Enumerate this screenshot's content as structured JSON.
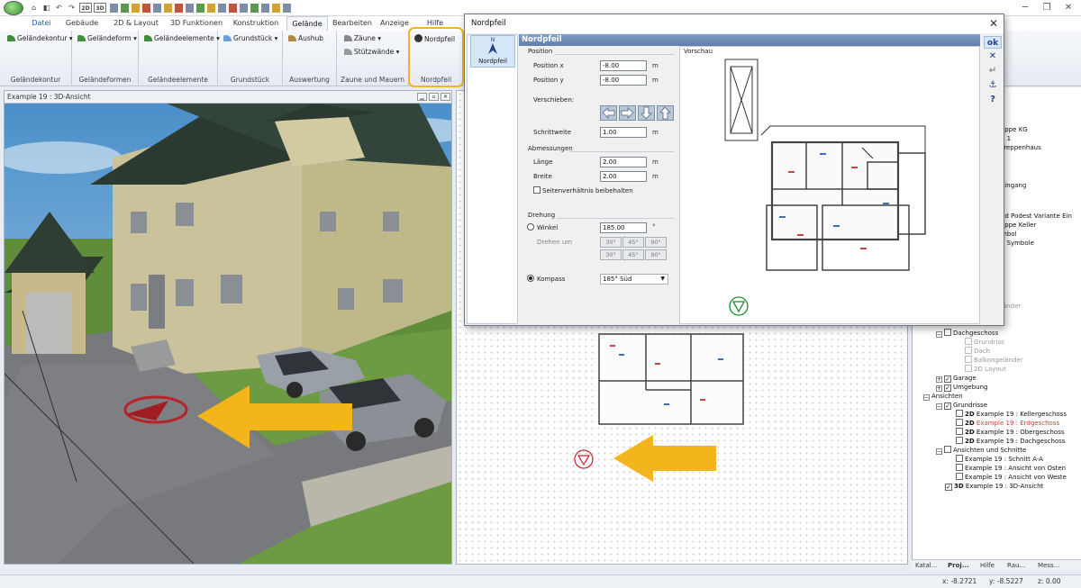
{
  "qat": {
    "items": [
      "⌂",
      "◧",
      "↶",
      "↷",
      "2D",
      "3D"
    ]
  },
  "ribbon": {
    "tabs": [
      "Datei",
      "Gebäude",
      "2D & Layout",
      "3D Funktionen",
      "Konstruktion",
      "Gelände",
      "Bearbeiten",
      "Anzeige",
      "Hilfe"
    ],
    "active_tab": "Gelände",
    "groups": [
      {
        "label": "Geländekontur",
        "buttons": [
          "Geländekontur ▾"
        ]
      },
      {
        "label": "Geländeformen",
        "buttons": [
          "Geländeform ▾"
        ]
      },
      {
        "label": "Geländeelemente",
        "buttons": [
          "Geländeelemente ▾"
        ]
      },
      {
        "label": "Grundstück",
        "buttons": [
          "Grundstück ▾"
        ]
      },
      {
        "label": "Auswertung",
        "buttons": [
          "Aushub"
        ]
      },
      {
        "label": "Zaune und Mauern",
        "buttons": [
          "Zäune ▾",
          "Stützwände ▾"
        ]
      },
      {
        "label": "Nordpfeil",
        "buttons": [
          "Nordpfeil"
        ]
      }
    ],
    "highlight_color": "#f2b51b"
  },
  "left_pane": {
    "title": "Example 19 : 3D-Ansicht"
  },
  "dialog": {
    "title": "Nordpfeil",
    "close": "✕",
    "sidebar": {
      "compass_letter": "N",
      "item": "Nordpfeil"
    },
    "header": "Nordpfeil",
    "position": {
      "section": "Position",
      "x_label": "Position x",
      "x_value": "-8.00",
      "y_label": "Position y",
      "y_value": "-8.00",
      "unit": "m",
      "move_label": "Verschieben:",
      "step_label": "Schrittweite",
      "step_value": "1.00"
    },
    "size": {
      "section": "Abmessungen",
      "length_label": "Länge",
      "length_value": "2.00",
      "width_label": "Breite",
      "width_value": "2.00",
      "unit": "m",
      "ratio_label": "Seitenverhältnis beibehalten"
    },
    "rotation": {
      "section": "Drehung",
      "angle_label": "Winkel",
      "angle_value": "185.00",
      "angle_unit": "°",
      "rotate_label": "Drehen um",
      "buttons": [
        "30°",
        "45°",
        "90°",
        "30°",
        "45°",
        "90°"
      ],
      "compass_label": "Kompass",
      "compass_value": "185° Süd"
    },
    "preview_label": "Vorschau",
    "side_buttons": [
      "ok",
      "✕",
      "↵",
      "⚓",
      "?"
    ]
  },
  "tree": {
    "partial": [
      "oppe KG",
      "E 1",
      "Treppenhaus",
      "eingang",
      "nd Podest Variante Ein",
      "oppe Keller",
      "mbol",
      "e Symbole",
      "länder"
    ],
    "items": [
      {
        "label": "Dachgeschoss",
        "indent": 0
      },
      {
        "label": "Grundriss",
        "indent": 1,
        "grey": true
      },
      {
        "label": "Dach",
        "indent": 1,
        "grey": true
      },
      {
        "label": "Balkongeländer",
        "indent": 1,
        "grey": true
      },
      {
        "label": "2D Layout",
        "indent": 1,
        "grey": true
      },
      {
        "label": "Garage",
        "indent": 0
      },
      {
        "label": "Umgebung",
        "indent": 0
      },
      {
        "label": "Ansichten",
        "indent": -1
      },
      {
        "label": "Grundrisse",
        "indent": 0
      },
      {
        "label": "Example 19 : Kellergeschoss",
        "indent": 1,
        "prefix": "2D"
      },
      {
        "label": "Example 19 : Erdgeschoss",
        "indent": 1,
        "prefix": "2D",
        "red": true
      },
      {
        "label": "Example 19 : Obergeschoss",
        "indent": 1,
        "prefix": "2D"
      },
      {
        "label": "Example 19 : Dachgeschoss",
        "indent": 1,
        "prefix": "2D"
      },
      {
        "label": "Ansichten und Schnitte",
        "indent": 0
      },
      {
        "label": "Example 19 : Schnitt A-A",
        "indent": 1
      },
      {
        "label": "Example 19 : Ansicht von Osten",
        "indent": 1
      },
      {
        "label": "Example 19 : Ansicht von Weste",
        "indent": 1
      },
      {
        "label": "Example 19 : 3D-Ansicht",
        "indent": 0,
        "prefix": "3D"
      }
    ]
  },
  "right_tabs": [
    "Katal...",
    "Proj...",
    "Hilfe",
    "Rau...",
    "Mess..."
  ],
  "status": {
    "x": "x: -8.2721",
    "y": "y: -8.5227",
    "z": "z: 0.00"
  },
  "colors": {
    "arrow": "#f2b51b",
    "north_arrow": "#c0272d",
    "accent": "#5f7fa9"
  }
}
